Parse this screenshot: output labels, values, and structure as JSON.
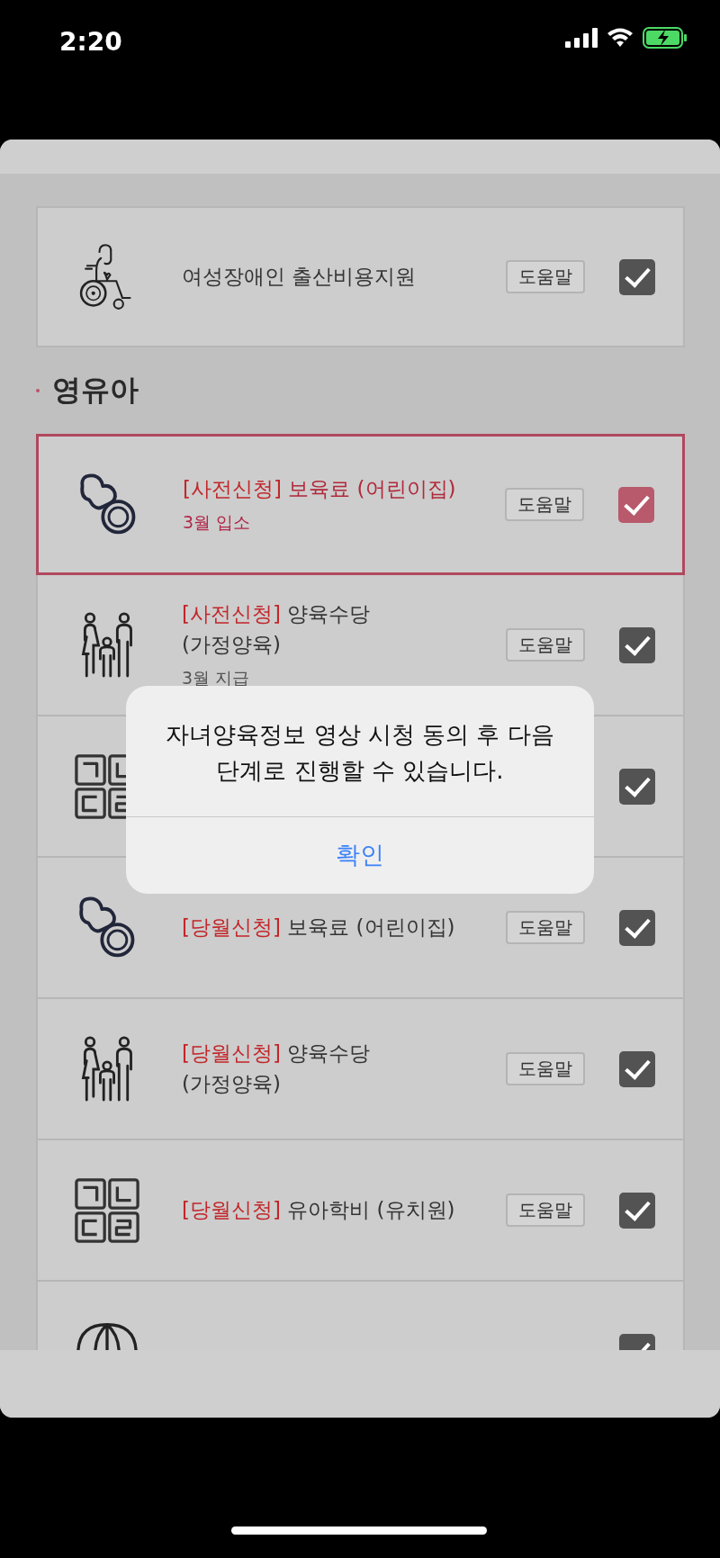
{
  "status_bar": {
    "time": "2:20",
    "battery_charging": true
  },
  "sections": [
    {
      "items": [
        {
          "kind": "wheelchair",
          "title": [
            "여성장애인 출산비용지원"
          ],
          "help": "도움말",
          "checked": true,
          "selected": false
        }
      ]
    },
    {
      "heading": "영유아",
      "items": [
        {
          "kind": "pacifier",
          "tag": "[사전신청]",
          "title": [
            "보육료 (어린이집)"
          ],
          "note": "3월 입소",
          "help": "도움말",
          "checked": true,
          "selected": true
        },
        {
          "kind": "family",
          "tag": "[사전신청]",
          "title": [
            "양육수당",
            "(가정양육)"
          ],
          "note": "3월 지급",
          "help": "도움말",
          "checked": true,
          "selected": false
        },
        {
          "kind": "blocks",
          "checked": true,
          "selected": false
        },
        {
          "kind": "pacifier",
          "tag": "[당월신청]",
          "title": [
            "보육료 (어린이집)"
          ],
          "help": "도움말",
          "checked": true,
          "selected": false
        },
        {
          "kind": "family",
          "tag": "[당월신청]",
          "title": [
            "양육수당",
            "(가정양육)"
          ],
          "help": "도움말",
          "checked": true,
          "selected": false
        },
        {
          "kind": "blocks",
          "tag": "[당월신청]",
          "title": [
            "유아학비 (유치원)"
          ],
          "help": "도움말",
          "checked": true,
          "selected": false
        },
        {
          "kind": "umbrella",
          "checked": true,
          "selected": false
        }
      ]
    }
  ],
  "alert": {
    "message": "자녀양육정보 영상 시청 동의 후 다음단계로 진행할 수 있습니다.",
    "button": "확인"
  }
}
